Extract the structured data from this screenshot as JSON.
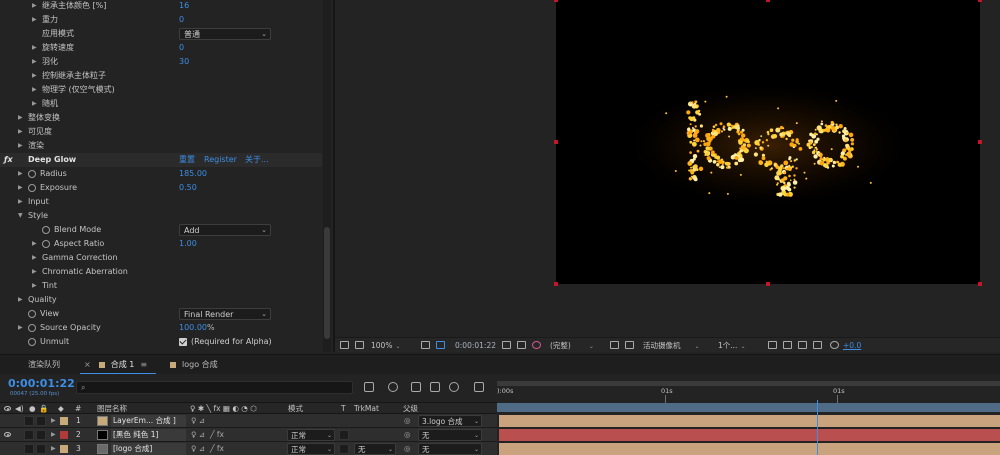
{
  "effects_panel": {
    "rows": [
      {
        "indent": 2,
        "twirl": "▶",
        "stopwatch": false,
        "label": "继承主体颜色 [%]",
        "value": "16"
      },
      {
        "indent": 2,
        "twirl": "▶",
        "stopwatch": false,
        "label": "重力",
        "value": "0"
      },
      {
        "indent": 2,
        "twirl": "",
        "stopwatch": false,
        "label": "应用模式",
        "dropdown": "普通"
      },
      {
        "indent": 2,
        "twirl": "▶",
        "stopwatch": false,
        "label": "旋转速度",
        "value": "0"
      },
      {
        "indent": 2,
        "twirl": "▶",
        "stopwatch": false,
        "label": "羽化",
        "value": "30"
      },
      {
        "indent": 2,
        "twirl": "▶",
        "stopwatch": false,
        "label": "控制继承主体粒子"
      },
      {
        "indent": 2,
        "twirl": "▶",
        "stopwatch": false,
        "label": "物理学 (仅空气模式)"
      },
      {
        "indent": 2,
        "twirl": "▶",
        "stopwatch": false,
        "label": "随机"
      },
      {
        "indent": 1,
        "twirl": "▶",
        "stopwatch": false,
        "label": "整体变换"
      },
      {
        "indent": 1,
        "twirl": "▶",
        "stopwatch": false,
        "label": "可见度"
      },
      {
        "indent": 1,
        "twirl": "▶",
        "stopwatch": false,
        "label": "渲染"
      },
      {
        "fx": true,
        "label": "Deep Glow",
        "links": [
          "重置",
          "Register",
          "关于..."
        ]
      },
      {
        "indent": 1,
        "twirl": "▶",
        "stopwatch": true,
        "label": "Radius",
        "value": "185.00"
      },
      {
        "indent": 1,
        "twirl": "▶",
        "stopwatch": true,
        "label": "Exposure",
        "value": "0.50"
      },
      {
        "indent": 1,
        "twirl": "▶",
        "stopwatch": false,
        "label": "Input"
      },
      {
        "indent": 1,
        "twirl": "▼",
        "stopwatch": false,
        "label": "Style"
      },
      {
        "indent": 2,
        "twirl": "",
        "stopwatch": true,
        "label": "Blend Mode",
        "dropdown": "Add"
      },
      {
        "indent": 2,
        "twirl": "▶",
        "stopwatch": true,
        "label": "Aspect Ratio",
        "value": "1.00"
      },
      {
        "indent": 2,
        "twirl": "▶",
        "stopwatch": false,
        "label": "Gamma Correction"
      },
      {
        "indent": 2,
        "twirl": "▶",
        "stopwatch": false,
        "label": "Chromatic Aberration"
      },
      {
        "indent": 2,
        "twirl": "▶",
        "stopwatch": false,
        "label": "Tint"
      },
      {
        "indent": 1,
        "twirl": "▶",
        "stopwatch": false,
        "label": "Quality"
      },
      {
        "indent": 1,
        "twirl": "",
        "stopwatch": true,
        "label": "View",
        "dropdown": "Final Render"
      },
      {
        "indent": 1,
        "twirl": "▶",
        "stopwatch": true,
        "label": "Source Opacity",
        "value": "100.00",
        "unit": "%"
      },
      {
        "indent": 1,
        "twirl": "",
        "stopwatch": true,
        "label": "Unmult",
        "checkbox": "(Required for Alpha)"
      }
    ]
  },
  "viewer": {
    "toolbar": {
      "zoom": "100%",
      "time": "0:00:01:22",
      "resolution": "(完整)",
      "camera": "活动摄像机",
      "views": "1个...",
      "exposure": "+0.0"
    }
  },
  "timeline": {
    "tabs": [
      {
        "label": "渲染队列",
        "active": false,
        "swatch": null
      },
      {
        "label": "合成 1",
        "active": true,
        "swatch": "#c8a97a"
      },
      {
        "label": "logo 合成",
        "active": false,
        "swatch": "#c8a97a"
      }
    ],
    "timecode": "0:00:01:22",
    "frames": "00047 (25.00 fps)",
    "search_placeholder": "",
    "ruler": {
      "start": "):00s",
      "mid": "01s",
      "end": "01s"
    },
    "columns": {
      "num": "#",
      "name": "图层名称",
      "mode": "模式",
      "t": "T",
      "trkmat": "TrkMat",
      "parent": "父级"
    },
    "layers": [
      {
        "num": "1",
        "name": "LayerEm... 合成 ]",
        "label_color": "#c8a97a",
        "thumb": "#c8a97a",
        "mode": "",
        "trkmat": "",
        "parent": "3.logo 合成",
        "track_color": "#c9a27e"
      },
      {
        "num": "2",
        "name": "[黑色 纯色 1]",
        "label_color": "#b23a3a",
        "thumb": "#000000",
        "mode": "正常",
        "trkmat": "",
        "parent": "无",
        "track_color": "#b94f4f"
      },
      {
        "num": "3",
        "name": "[logo 合成]",
        "label_color": "#c8a97a",
        "thumb": "#6a6a6a",
        "mode": "正常",
        "trkmat": "无",
        "parent": "无",
        "track_color": "#c9a27e"
      }
    ]
  }
}
